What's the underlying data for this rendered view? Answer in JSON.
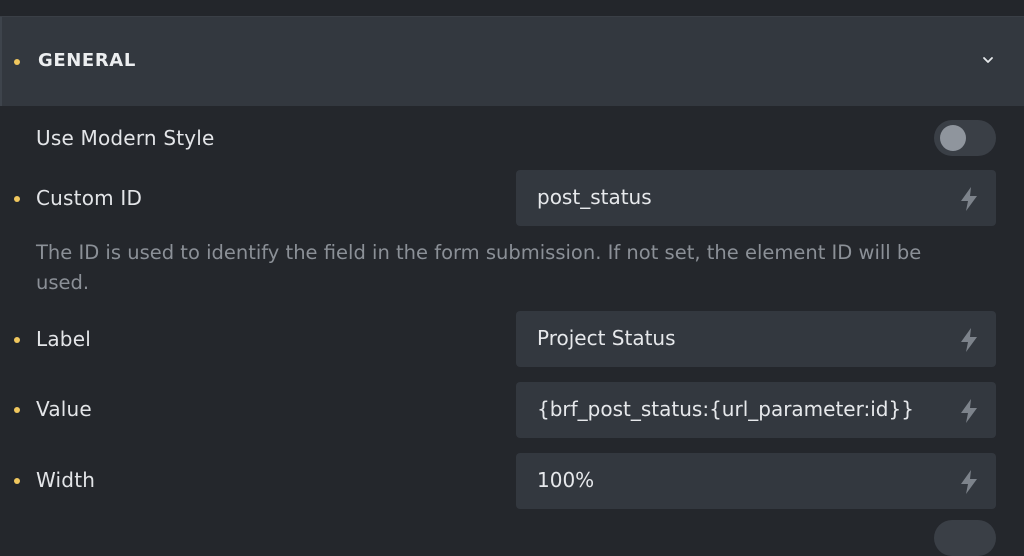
{
  "section": {
    "title": "GENERAL",
    "chevron_icon": "chevron-down-icon"
  },
  "modern_style": {
    "label": "Use Modern Style",
    "enabled": false
  },
  "fields": {
    "custom_id": {
      "label": "Custom ID",
      "value": "post_status",
      "helper": "The ID is used to identify the field in the form submission. If not set, the element ID will be used."
    },
    "label": {
      "label": "Label",
      "value": "Project Status"
    },
    "value": {
      "label": "Value",
      "value": "{brf_post_status:{url_parameter:id}}"
    },
    "width": {
      "label": "Width",
      "value": "100%"
    }
  },
  "icons": {
    "dynamic_data": "bolt-icon"
  },
  "colors": {
    "background": "#24272c",
    "panel": "#33383f",
    "accent_dot": "#f0c75e",
    "muted_text": "#8b9097"
  }
}
